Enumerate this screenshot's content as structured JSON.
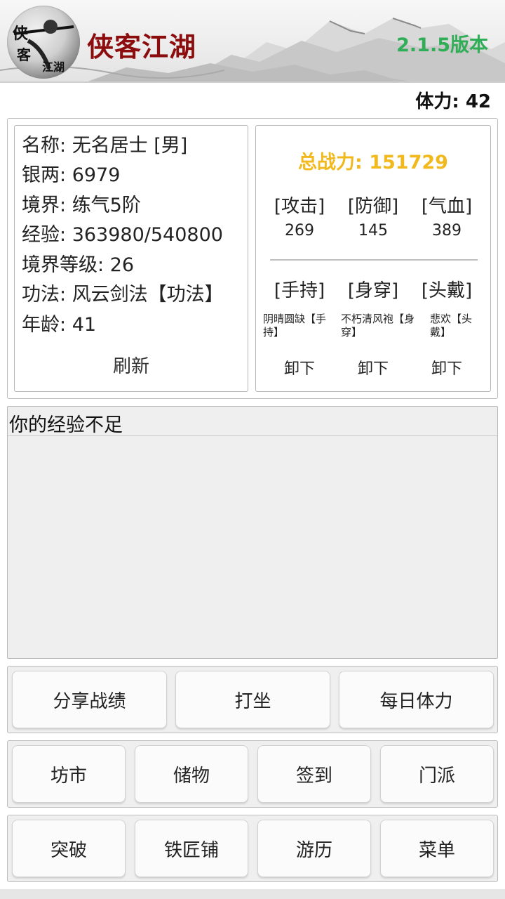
{
  "header": {
    "title": "侠客江湖",
    "version": "2.1.5版本",
    "logo_text": [
      "侠",
      "客",
      "江湖"
    ]
  },
  "stamina": {
    "label": "体力",
    "value": "42"
  },
  "character": {
    "rows": [
      {
        "label": "名称",
        "value": "无名居士 [男]"
      },
      {
        "label": "银两",
        "value": "6979"
      },
      {
        "label": "境界",
        "value": "练气5阶"
      },
      {
        "label": "经验",
        "value": "363980/540800"
      },
      {
        "label": "境界等级",
        "value": "26"
      },
      {
        "label": "功法",
        "value": "风云剑法【功法】"
      },
      {
        "label": "年龄",
        "value": "41"
      }
    ],
    "refresh_label": "刷新"
  },
  "combat": {
    "power_label": "总战力",
    "power_value": "151729",
    "stats": [
      {
        "label": "[攻击]",
        "value": "269"
      },
      {
        "label": "[防御]",
        "value": "145"
      },
      {
        "label": "[气血]",
        "value": "389"
      }
    ],
    "equipment": [
      {
        "slot": "[手持]",
        "item": "阴晴圆缺【手持】",
        "action": "卸下"
      },
      {
        "slot": "[身穿]",
        "item": "不朽清风袍【身穿】",
        "action": "卸下"
      },
      {
        "slot": "[头戴]",
        "item": "悲欢【头戴】",
        "action": "卸下"
      }
    ]
  },
  "log": {
    "message": "你的经验不足"
  },
  "actions": {
    "row1": [
      "分享战绩",
      "打坐",
      "每日体力"
    ],
    "row2": [
      "坊市",
      "储物",
      "签到",
      "门派"
    ],
    "row3": [
      "突破",
      "铁匠铺",
      "游历",
      "菜单"
    ]
  },
  "colors": {
    "title": "#8b0d0d",
    "version": "#2fae57",
    "power": "#f1b91d"
  }
}
